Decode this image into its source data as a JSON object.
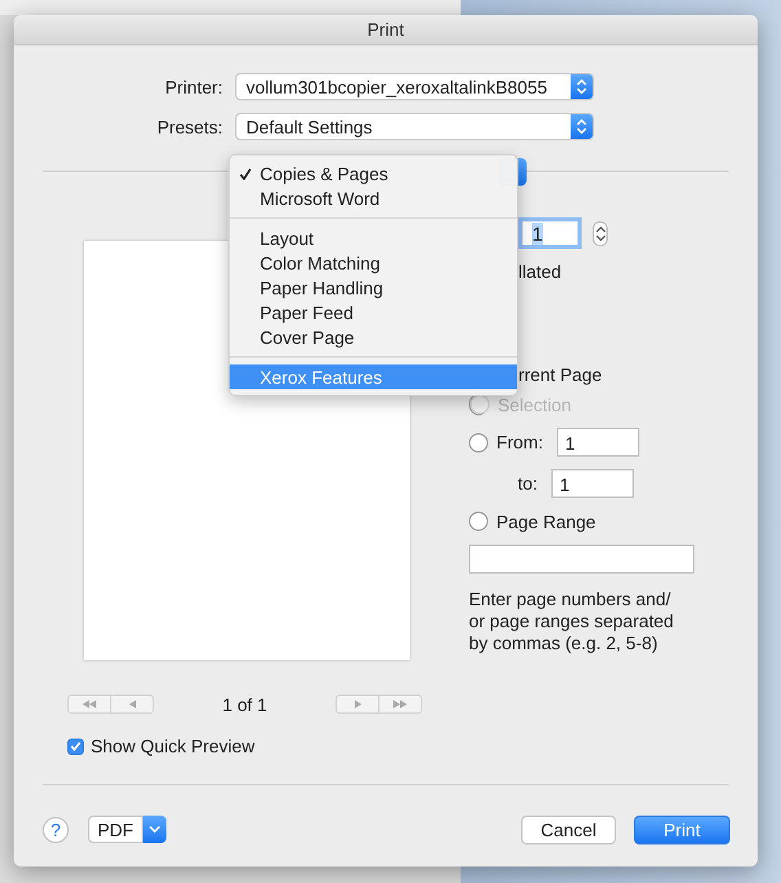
{
  "window": {
    "title": "Print"
  },
  "printer": {
    "label": "Printer:",
    "value": "vollum301bcopier_xeroxaltalinkB8055"
  },
  "presets": {
    "label": "Presets:",
    "value": "Default Settings"
  },
  "panel_menu": {
    "groups": [
      [
        {
          "label": "Copies & Pages",
          "checked": true,
          "selected": false
        },
        {
          "label": "Microsoft Word",
          "checked": false,
          "selected": false
        }
      ],
      [
        {
          "label": "Layout",
          "checked": false,
          "selected": false
        },
        {
          "label": "Color Matching",
          "checked": false,
          "selected": false
        },
        {
          "label": "Paper Handling",
          "checked": false,
          "selected": false
        },
        {
          "label": "Paper Feed",
          "checked": false,
          "selected": false
        },
        {
          "label": "Cover Page",
          "checked": false,
          "selected": false
        }
      ],
      [
        {
          "label": "Xerox Features",
          "checked": false,
          "selected": true
        }
      ]
    ]
  },
  "copies": {
    "value": "1"
  },
  "collated": {
    "label": "llated"
  },
  "pages": {
    "options": [
      {
        "kind": "clipped",
        "label": "rrent Page"
      },
      {
        "kind": "radio",
        "label": "Selection",
        "selected": false,
        "disabled": true
      },
      {
        "kind": "from",
        "label": "From:",
        "selected": false,
        "disabled": false,
        "value": "1"
      },
      {
        "kind": "to",
        "label": "to:",
        "value": "1"
      },
      {
        "kind": "range",
        "label": "Page Range",
        "selected": false,
        "disabled": false
      }
    ]
  },
  "hint": "Enter page numbers and/ or page ranges separated by commas (e.g. 2, 5-8)",
  "preview": {
    "page_indicator": "1 of 1"
  },
  "show_quick_preview": {
    "label": "Show Quick Preview",
    "checked": true
  },
  "footer": {
    "help": "?",
    "pdf": "PDF",
    "buttons": [
      {
        "label": "Cancel",
        "kind": "normal"
      },
      {
        "label": "Print",
        "kind": "default"
      }
    ]
  }
}
